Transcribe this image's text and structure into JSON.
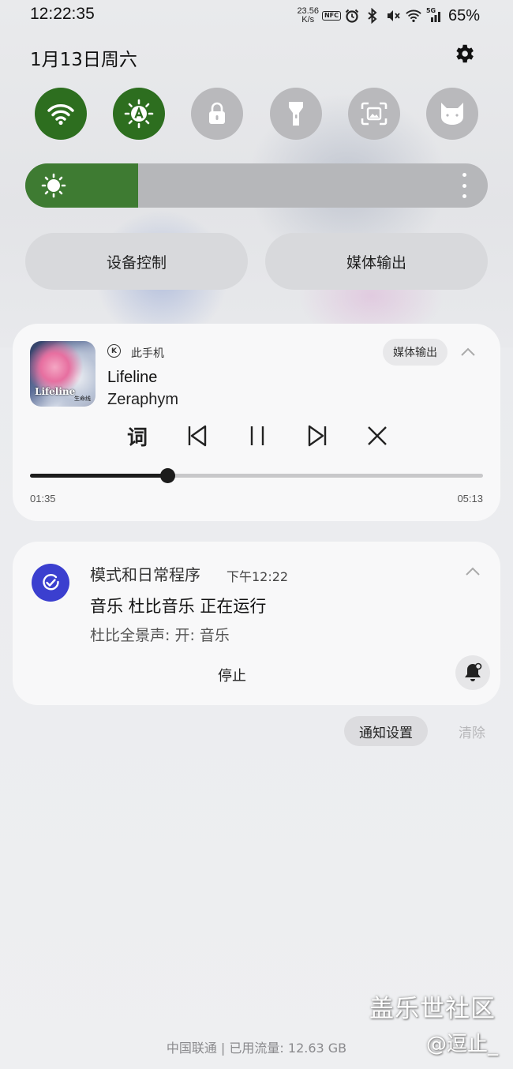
{
  "status_bar": {
    "time": "12:22:35",
    "net_speed_value": "23.56",
    "net_speed_unit": "K/s",
    "nfc_label": "NFC",
    "network_label": "5G",
    "battery": "65%"
  },
  "header": {
    "date": "1月13日周六"
  },
  "quick_settings": {
    "toggles": [
      {
        "name": "wifi",
        "icon": "wifi-icon",
        "active": true
      },
      {
        "name": "auto-brightness",
        "icon": "auto-brightness-icon",
        "active": true
      },
      {
        "name": "rotation-lock",
        "icon": "lock-icon",
        "active": false
      },
      {
        "name": "flashlight",
        "icon": "flashlight-icon",
        "active": false
      },
      {
        "name": "screenshot",
        "icon": "screenshot-icon",
        "active": false
      },
      {
        "name": "cat-app",
        "icon": "cat-icon",
        "active": false
      }
    ],
    "brightness_level": 0.244,
    "device_control_label": "设备控制",
    "media_output_label": "媒体输出"
  },
  "media_player": {
    "source_badge": "K",
    "source": "此手机",
    "output_chip": "媒体输出",
    "album_art_text": "Lifeline",
    "album_art_subtext": "生命线",
    "title": "Lifeline",
    "artist": "Zeraphym",
    "lyrics_button": "词",
    "current_time": "01:35",
    "total_time": "05:13",
    "progress": 0.3035
  },
  "notification": {
    "app": "模式和日常程序",
    "time": "下午12:22",
    "title": "音乐 杜比音乐 正在运行",
    "body": "杜比全景声: 开: 音乐",
    "action": "停止"
  },
  "footer_actions": {
    "settings": "通知设置",
    "clear": "清除"
  },
  "watermark": {
    "line1": "盖乐世社区",
    "line2": "@逗止_"
  },
  "carrier_info": "中国联通 | 已用流量: 12.63 GB",
  "colors": {
    "toggle_on": "#2d6e1f",
    "toggle_off": "#b9b9bc",
    "brightness_fill": "#3e7b32",
    "notif_icon": "#3b3fcf"
  }
}
